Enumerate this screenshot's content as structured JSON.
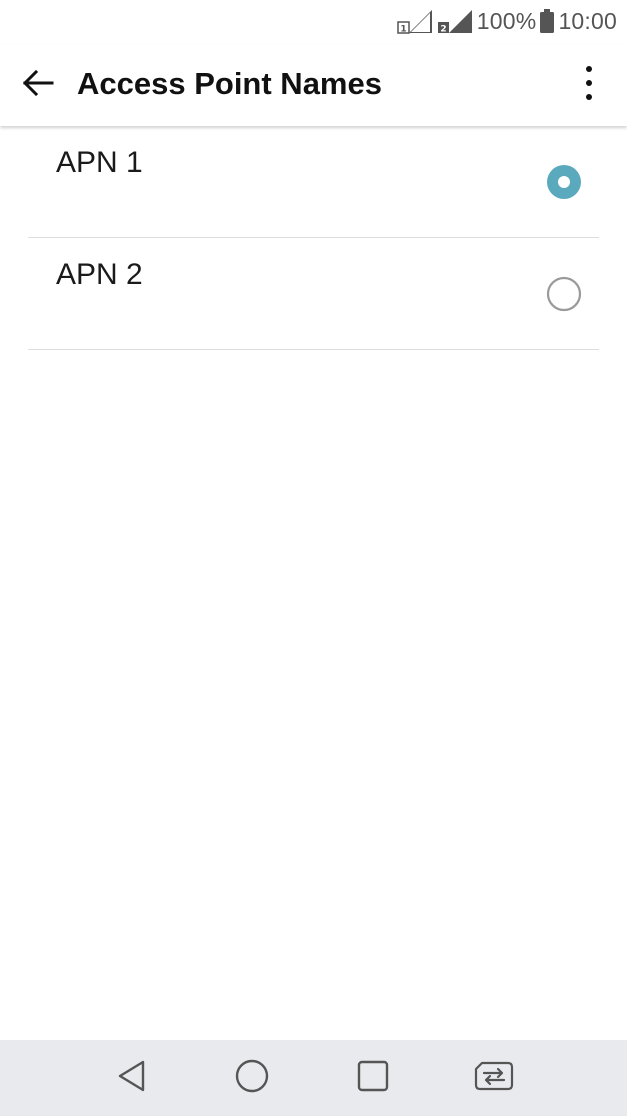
{
  "status_bar": {
    "battery_percent": "100%",
    "time": "10:00",
    "sim1_label": "1",
    "sim2_label": "2",
    "icons": [
      "sim1-signal-icon",
      "sim2-signal-icon",
      "battery-icon"
    ]
  },
  "app_bar": {
    "title": "Access Point Names",
    "back_icon": "arrow-back-icon",
    "menu_icon": "more-vert-icon"
  },
  "apns": [
    {
      "name": "APN 1",
      "selected": true
    },
    {
      "name": "APN 2",
      "selected": false
    }
  ],
  "nav_bar": {
    "icons": [
      "back-triangle-icon",
      "home-circle-icon",
      "recents-square-icon",
      "sim-switch-icon"
    ]
  },
  "colors": {
    "accent": "#5aa9bd",
    "radio_off": "#9a9a9a",
    "nav_bg": "#e9eaed"
  }
}
